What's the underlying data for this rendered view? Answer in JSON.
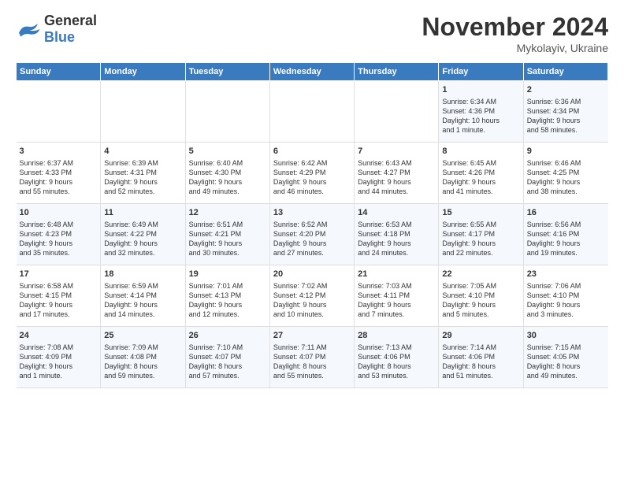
{
  "header": {
    "logo_general": "General",
    "logo_blue": "Blue",
    "month_title": "November 2024",
    "location": "Mykolayiv, Ukraine"
  },
  "days_of_week": [
    "Sunday",
    "Monday",
    "Tuesday",
    "Wednesday",
    "Thursday",
    "Friday",
    "Saturday"
  ],
  "weeks": [
    [
      {
        "day": "",
        "info": ""
      },
      {
        "day": "",
        "info": ""
      },
      {
        "day": "",
        "info": ""
      },
      {
        "day": "",
        "info": ""
      },
      {
        "day": "",
        "info": ""
      },
      {
        "day": "1",
        "info": "Sunrise: 6:34 AM\nSunset: 4:36 PM\nDaylight: 10 hours\nand 1 minute."
      },
      {
        "day": "2",
        "info": "Sunrise: 6:36 AM\nSunset: 4:34 PM\nDaylight: 9 hours\nand 58 minutes."
      }
    ],
    [
      {
        "day": "3",
        "info": "Sunrise: 6:37 AM\nSunset: 4:33 PM\nDaylight: 9 hours\nand 55 minutes."
      },
      {
        "day": "4",
        "info": "Sunrise: 6:39 AM\nSunset: 4:31 PM\nDaylight: 9 hours\nand 52 minutes."
      },
      {
        "day": "5",
        "info": "Sunrise: 6:40 AM\nSunset: 4:30 PM\nDaylight: 9 hours\nand 49 minutes."
      },
      {
        "day": "6",
        "info": "Sunrise: 6:42 AM\nSunset: 4:29 PM\nDaylight: 9 hours\nand 46 minutes."
      },
      {
        "day": "7",
        "info": "Sunrise: 6:43 AM\nSunset: 4:27 PM\nDaylight: 9 hours\nand 44 minutes."
      },
      {
        "day": "8",
        "info": "Sunrise: 6:45 AM\nSunset: 4:26 PM\nDaylight: 9 hours\nand 41 minutes."
      },
      {
        "day": "9",
        "info": "Sunrise: 6:46 AM\nSunset: 4:25 PM\nDaylight: 9 hours\nand 38 minutes."
      }
    ],
    [
      {
        "day": "10",
        "info": "Sunrise: 6:48 AM\nSunset: 4:23 PM\nDaylight: 9 hours\nand 35 minutes."
      },
      {
        "day": "11",
        "info": "Sunrise: 6:49 AM\nSunset: 4:22 PM\nDaylight: 9 hours\nand 32 minutes."
      },
      {
        "day": "12",
        "info": "Sunrise: 6:51 AM\nSunset: 4:21 PM\nDaylight: 9 hours\nand 30 minutes."
      },
      {
        "day": "13",
        "info": "Sunrise: 6:52 AM\nSunset: 4:20 PM\nDaylight: 9 hours\nand 27 minutes."
      },
      {
        "day": "14",
        "info": "Sunrise: 6:53 AM\nSunset: 4:18 PM\nDaylight: 9 hours\nand 24 minutes."
      },
      {
        "day": "15",
        "info": "Sunrise: 6:55 AM\nSunset: 4:17 PM\nDaylight: 9 hours\nand 22 minutes."
      },
      {
        "day": "16",
        "info": "Sunrise: 6:56 AM\nSunset: 4:16 PM\nDaylight: 9 hours\nand 19 minutes."
      }
    ],
    [
      {
        "day": "17",
        "info": "Sunrise: 6:58 AM\nSunset: 4:15 PM\nDaylight: 9 hours\nand 17 minutes."
      },
      {
        "day": "18",
        "info": "Sunrise: 6:59 AM\nSunset: 4:14 PM\nDaylight: 9 hours\nand 14 minutes."
      },
      {
        "day": "19",
        "info": "Sunrise: 7:01 AM\nSunset: 4:13 PM\nDaylight: 9 hours\nand 12 minutes."
      },
      {
        "day": "20",
        "info": "Sunrise: 7:02 AM\nSunset: 4:12 PM\nDaylight: 9 hours\nand 10 minutes."
      },
      {
        "day": "21",
        "info": "Sunrise: 7:03 AM\nSunset: 4:11 PM\nDaylight: 9 hours\nand 7 minutes."
      },
      {
        "day": "22",
        "info": "Sunrise: 7:05 AM\nSunset: 4:10 PM\nDaylight: 9 hours\nand 5 minutes."
      },
      {
        "day": "23",
        "info": "Sunrise: 7:06 AM\nSunset: 4:10 PM\nDaylight: 9 hours\nand 3 minutes."
      }
    ],
    [
      {
        "day": "24",
        "info": "Sunrise: 7:08 AM\nSunset: 4:09 PM\nDaylight: 9 hours\nand 1 minute."
      },
      {
        "day": "25",
        "info": "Sunrise: 7:09 AM\nSunset: 4:08 PM\nDaylight: 8 hours\nand 59 minutes."
      },
      {
        "day": "26",
        "info": "Sunrise: 7:10 AM\nSunset: 4:07 PM\nDaylight: 8 hours\nand 57 minutes."
      },
      {
        "day": "27",
        "info": "Sunrise: 7:11 AM\nSunset: 4:07 PM\nDaylight: 8 hours\nand 55 minutes."
      },
      {
        "day": "28",
        "info": "Sunrise: 7:13 AM\nSunset: 4:06 PM\nDaylight: 8 hours\nand 53 minutes."
      },
      {
        "day": "29",
        "info": "Sunrise: 7:14 AM\nSunset: 4:06 PM\nDaylight: 8 hours\nand 51 minutes."
      },
      {
        "day": "30",
        "info": "Sunrise: 7:15 AM\nSunset: 4:05 PM\nDaylight: 8 hours\nand 49 minutes."
      }
    ]
  ]
}
